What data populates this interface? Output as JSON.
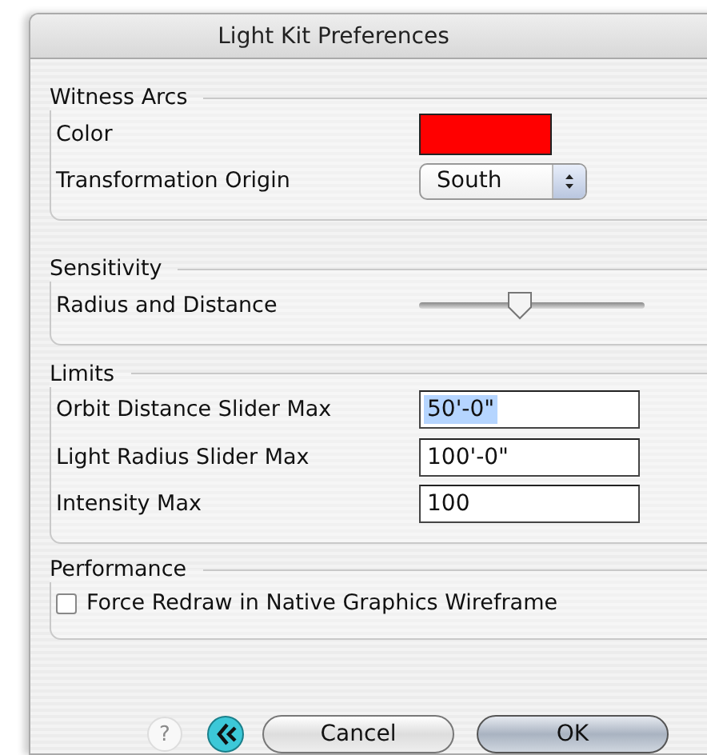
{
  "window": {
    "title": "Light Kit Preferences"
  },
  "groups": [
    {
      "title": "Witness Arcs",
      "rows": [
        {
          "kind": "color",
          "label": "Color",
          "color": "#ff0000"
        },
        {
          "kind": "popup",
          "label": "Transformation Origin",
          "value": "South"
        }
      ]
    },
    {
      "title": "Sensitivity",
      "rows": [
        {
          "kind": "slider",
          "label": "Radius and Distance",
          "level": 0.45
        }
      ]
    },
    {
      "title": "Limits",
      "rows": [
        {
          "kind": "field",
          "label": "Orbit Distance Slider Max",
          "value": "50'-0\"",
          "text_selected": true
        },
        {
          "kind": "field",
          "label": "Light Radius Slider Max",
          "value": "100'-0\"",
          "text_selected": false
        },
        {
          "kind": "field",
          "label": "Intensity Max",
          "value": "100",
          "text_selected": false
        }
      ]
    },
    {
      "title": "Performance",
      "rows": [
        {
          "kind": "checkbox",
          "label": "Force Redraw in Native Graphics Wireframe",
          "checked": false
        }
      ]
    }
  ],
  "buttons": [
    {
      "kind": "help",
      "label": "?",
      "disabled": true
    },
    {
      "kind": "back"
    },
    {
      "kind": "push",
      "label": "Cancel",
      "default": false
    },
    {
      "kind": "push",
      "label": "OK",
      "default": true
    }
  ]
}
